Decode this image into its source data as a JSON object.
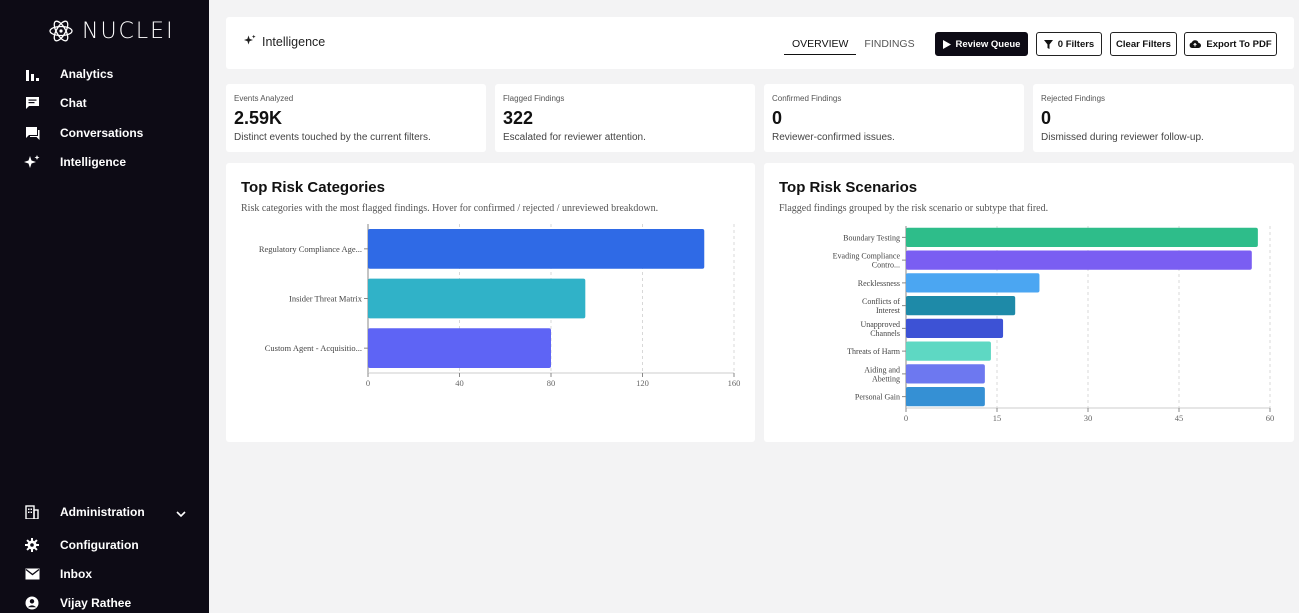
{
  "app": {
    "logo_text": "NUCLEI"
  },
  "sidebar": {
    "items": [
      {
        "label": "Analytics",
        "icon": "bar-chart-icon"
      },
      {
        "label": "Chat",
        "icon": "chat-icon"
      },
      {
        "label": "Conversations",
        "icon": "conversations-icon"
      },
      {
        "label": "Intelligence",
        "icon": "sparkle-icon"
      }
    ],
    "bottom_items": [
      {
        "label": "Administration",
        "icon": "building-icon"
      },
      {
        "label": "Configuration",
        "icon": "gear-icon"
      },
      {
        "label": "Inbox",
        "icon": "mail-icon"
      },
      {
        "label": "Vijay Rathee",
        "icon": "user-icon"
      }
    ]
  },
  "header": {
    "title": "Intelligence",
    "tabs": [
      "OVERVIEW",
      "FINDINGS"
    ],
    "active_tab": "OVERVIEW",
    "review_queue": "Review Queue",
    "filters": "0 Filters",
    "clear_filters": "Clear Filters",
    "export": "Export To PDF"
  },
  "stats": [
    {
      "label": "Events Analyzed",
      "value": "2.59K",
      "desc": "Distinct events touched by the current filters."
    },
    {
      "label": "Flagged Findings",
      "value": "322",
      "desc": "Escalated for reviewer attention."
    },
    {
      "label": "Confirmed Findings",
      "value": "0",
      "desc": "Reviewer-confirmed issues."
    },
    {
      "label": "Rejected Findings",
      "value": "0",
      "desc": "Dismissed during reviewer follow-up."
    }
  ],
  "colors": {
    "sidebar_bg": "#0d0b15",
    "page_bg": "#f3f3f4"
  },
  "chart_data": [
    {
      "type": "bar",
      "orientation": "horizontal",
      "title": "Top Risk Categories",
      "subtitle": "Risk categories with the most flagged findings. Hover for confirmed / rejected / unreviewed breakdown.",
      "categories": [
        "Regulatory Compliance Age...",
        "Insider Threat Matrix",
        "Custom Agent - Acquisitio..."
      ],
      "values": [
        147,
        95,
        80
      ],
      "colors": [
        "#2f6ae6",
        "#30b2c8",
        "#5e64f5"
      ],
      "xlim": [
        0,
        160
      ],
      "xticks": [
        0,
        40,
        80,
        120,
        160
      ],
      "grid": true
    },
    {
      "type": "bar",
      "orientation": "horizontal",
      "title": "Top Risk Scenarios",
      "subtitle": "Flagged findings grouped by the risk scenario or subtype that fired.",
      "categories": [
        "Boundary Testing",
        "Evading Compliance Contro...",
        "Recklessness",
        "Conflicts of Interest",
        "Unapproved Channels",
        "Threats of Harm",
        "Aiding and Abetting",
        "Personal Gain"
      ],
      "values": [
        58,
        57,
        22,
        18,
        16,
        14,
        13,
        13
      ],
      "colors": [
        "#2ebd8a",
        "#7a5ef2",
        "#4ba6f2",
        "#1e8aa8",
        "#3d52d5",
        "#5ed8c3",
        "#6d78f0",
        "#3590d4"
      ],
      "xlim": [
        0,
        60
      ],
      "xticks": [
        0,
        15,
        30,
        45,
        60
      ],
      "grid": true
    }
  ]
}
